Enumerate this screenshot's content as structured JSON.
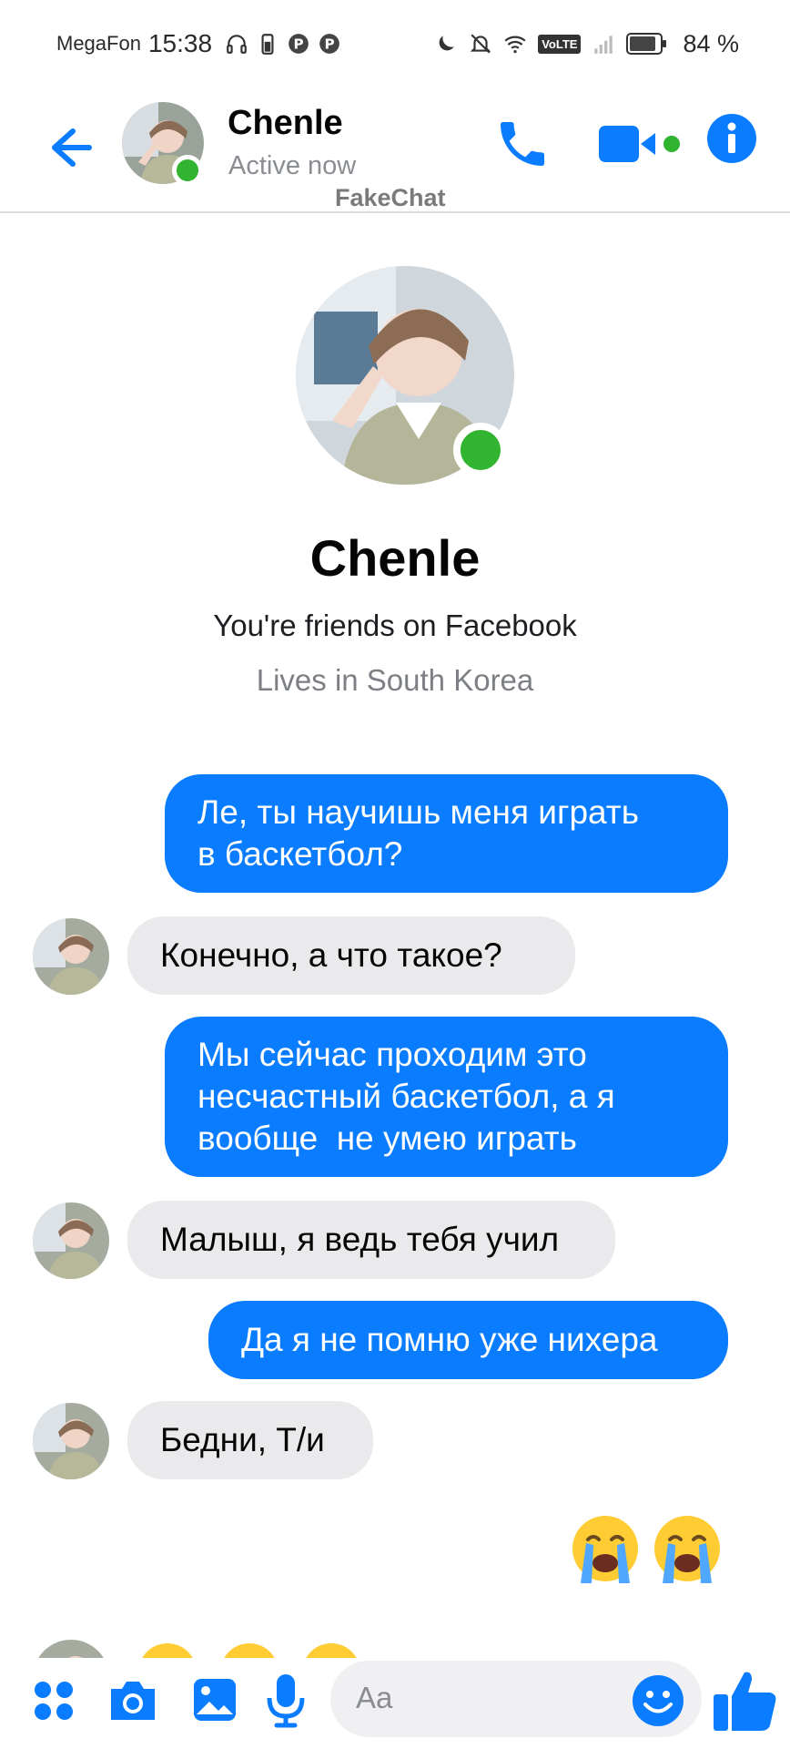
{
  "status_bar": {
    "carrier": "MegaFon",
    "time": "15:38",
    "network_badge": "VoLTE",
    "battery": "84 %"
  },
  "header": {
    "name": "Chenle",
    "status": "Active now",
    "watermark": "FakeChat"
  },
  "profile": {
    "name": "Chenle",
    "friends_text": "You're friends on Facebook",
    "lives_text": "Lives in South Korea"
  },
  "messages": [
    {
      "from": "me",
      "lines": [
        "Ле, ты научишь меня играть",
        "в баскетбол?"
      ]
    },
    {
      "from": "them",
      "lines": [
        "Конечно, а что такое?"
      ]
    },
    {
      "from": "me",
      "lines": [
        "Мы сейчас проходим это",
        "несчастный баскетбол, а я",
        "вообще  не умею играть"
      ]
    },
    {
      "from": "them",
      "lines": [
        "Малыш, я ведь тебя учил"
      ]
    },
    {
      "from": "me",
      "lines": [
        "Да я не помню уже нихера"
      ]
    },
    {
      "from": "them",
      "lines": [
        "Бедни, Т/и"
      ]
    },
    {
      "from": "me",
      "emoji": "loudly-crying-face x2"
    }
  ],
  "composer": {
    "placeholder": "Aa"
  },
  "colors": {
    "accent": "#0a7cff",
    "incoming_bubble": "#eaeaec",
    "online": "#31b531"
  }
}
